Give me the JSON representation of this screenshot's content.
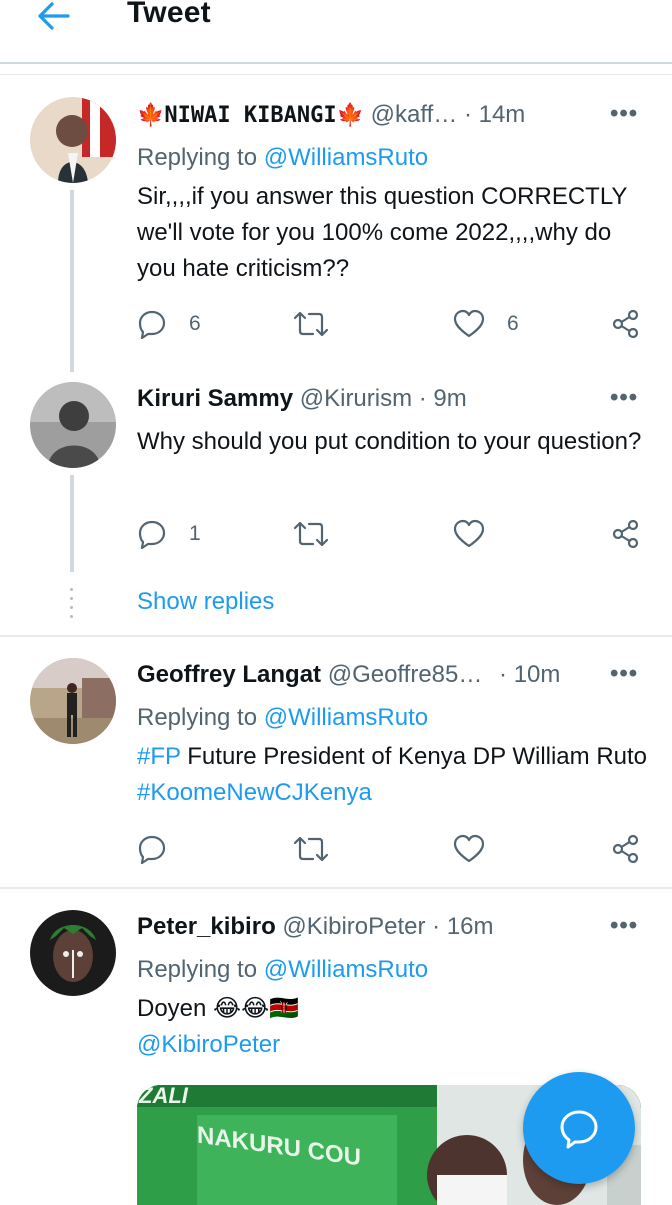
{
  "header": {
    "title": "Tweet",
    "back_icon": "arrow-left-icon",
    "accent": "#1d9bf0"
  },
  "tweets": [
    {
      "name": "🍁NIWAI KIBANGI🍁",
      "handle": "@kaff…",
      "time": "· 14m",
      "more": "•••",
      "replying_prefix": "Replying to",
      "replying_to": "@WilliamsRuto",
      "text": "Sir,,,,if you answer this question CORRECTLY we'll vote for you 100% come 2022,,,,why do you hate criticism??",
      "replies": "6",
      "retweets": "",
      "likes": "6"
    },
    {
      "name": "Kiruri Sammy",
      "handle": "@Kirurism",
      "time": "· 9m",
      "more": "•••",
      "text": "Why should you put condition to your question?",
      "replies": "1",
      "retweets": "",
      "likes": ""
    },
    {
      "name": "Geoffrey Langat",
      "handle": "@Geoffre85…",
      "time": "· 10m",
      "more": "•••",
      "replying_prefix": "Replying to",
      "replying_to": "@WilliamsRuto",
      "text_tag1": "#FP",
      "text_mid": " Future President of Kenya DP William Ruto ",
      "text_tag2": "#KoomeNewCJKenya",
      "replies": "",
      "retweets": "",
      "likes": ""
    },
    {
      "name": "Peter_kibiro",
      "handle": "@KibiroPeter",
      "time": "· 16m",
      "more": "•••",
      "replying_prefix": "Replying to",
      "replying_to": "@WilliamsRuto",
      "text": "Doyen 😂😂🇰🇪",
      "mention": "@KibiroPeter",
      "media_text_top": "ZALI",
      "media_text": "NAKURU COU"
    }
  ],
  "show_replies": "Show replies",
  "fab_icon": "compose-reply-icon",
  "icons": [
    "reply-icon",
    "retweet-icon",
    "like-icon",
    "share-icon"
  ]
}
